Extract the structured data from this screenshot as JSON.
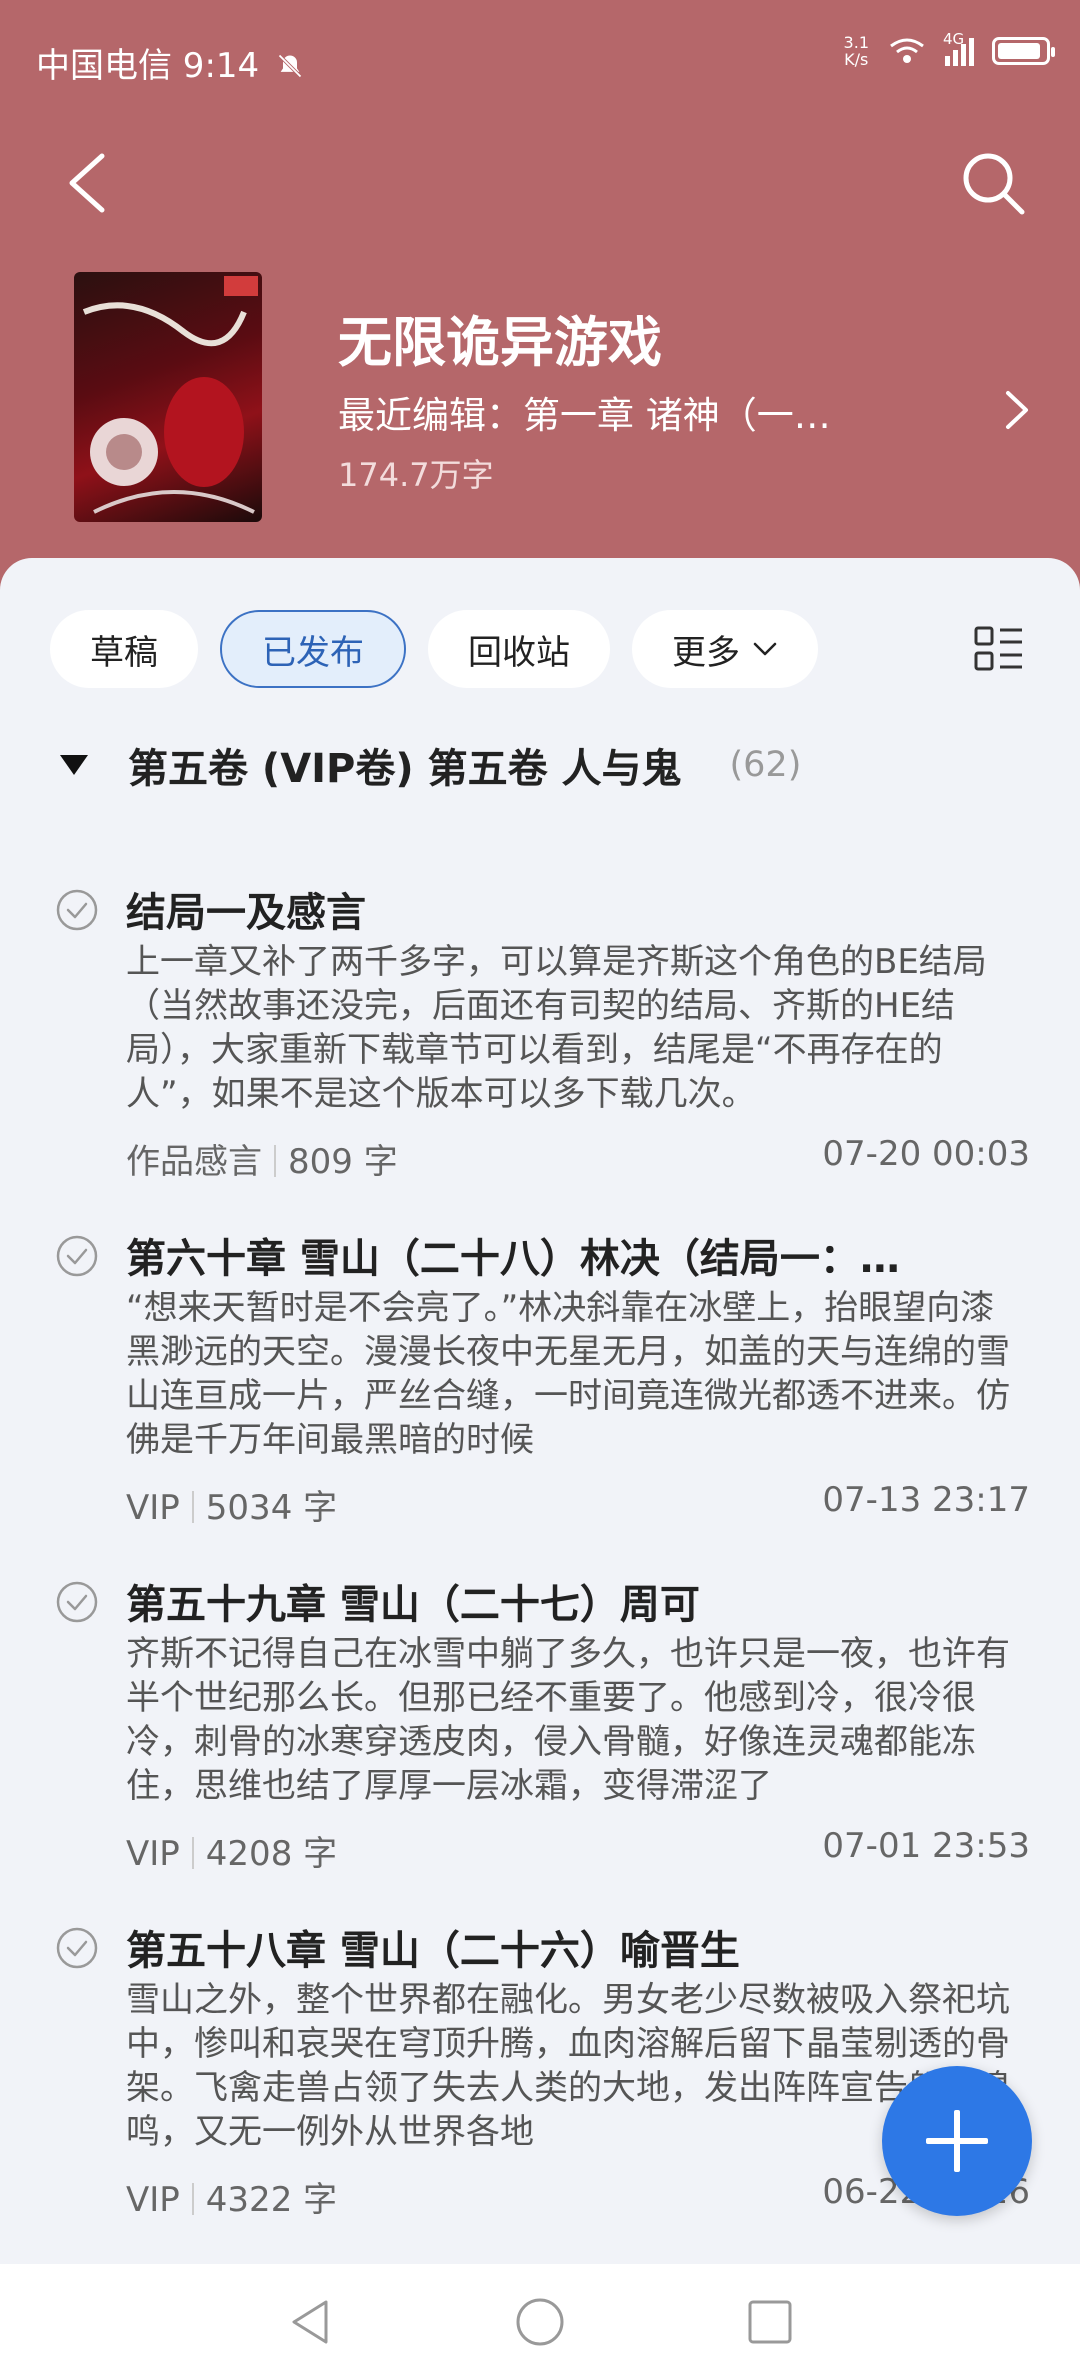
{
  "status": {
    "carrier_time": "中国电信 9:14",
    "speed_top": "3.1",
    "speed_bottom": "K/s",
    "network": "4G"
  },
  "book": {
    "title": "无限诡异游戏",
    "recent_edit": "最近编辑：第一章 诸神（一…",
    "word_count": "174.7万字"
  },
  "tabs": [
    {
      "label": "草稿"
    },
    {
      "label": "已发布"
    },
    {
      "label": "回收站"
    },
    {
      "label": "更多"
    }
  ],
  "volume": {
    "title": "第五卷 (VIP卷) 第五卷 人与鬼",
    "count": "(62)"
  },
  "chapters": [
    {
      "title": "结局一及感言",
      "excerpt": "上一章又补了两千多字，可以算是齐斯这个角色的BE结局（当然故事还没完，后面还有司契的结局、齐斯的HE结局），大家重新下载章节可以看到，结尾是“不再存在的人”，如果不是这个版本可以多下载几次。",
      "type": "作品感言",
      "words": "809 字",
      "date": "07-20 00:03"
    },
    {
      "title": "第六十章 雪山（二十八）林决（结局一：…",
      "excerpt": "“想来天暂时是不会亮了。”林决斜靠在冰壁上，抬眼望向漆黑渺远的天空。漫漫长夜中无星无月，如盖的天与连绵的雪山连亘成一片，严丝合缝，一时间竟连微光都透不进来。仿佛是千万年间最黑暗的时候",
      "type": "VIP",
      "words": "5034 字",
      "date": "07-13 23:17"
    },
    {
      "title": "第五十九章 雪山（二十七）周可",
      "excerpt": "齐斯不记得自己在冰雪中躺了多久，也许只是一夜，也许有半个世纪那么长。但那已经不重要了。他感到冷，很冷很冷，刺骨的冰寒穿透皮肉，侵入骨髓，好像连灵魂都能冻住，思维也结了厚厚一层冰霜，变得滞涩了",
      "type": "VIP",
      "words": "4208 字",
      "date": "07-01 23:53"
    },
    {
      "title": "第五十八章 雪山（二十六）喻晋生",
      "excerpt": "雪山之外，整个世界都在融化。男女老少尽数被吸入祭祀坑中，惨叫和哀哭在穹顶升腾，血肉溶解后留下晶莹剔透的骨架。飞禽走兽占领了失去人类的大地，发出阵阵宣告般的嗥鸣，又无一例外从世界各地",
      "type": "VIP",
      "words": "4322 字",
      "date": "06-22 23:26"
    }
  ],
  "colors": {
    "header": "#b5676a",
    "accent": "#2d78e6",
    "background": "#f1f3f8"
  }
}
